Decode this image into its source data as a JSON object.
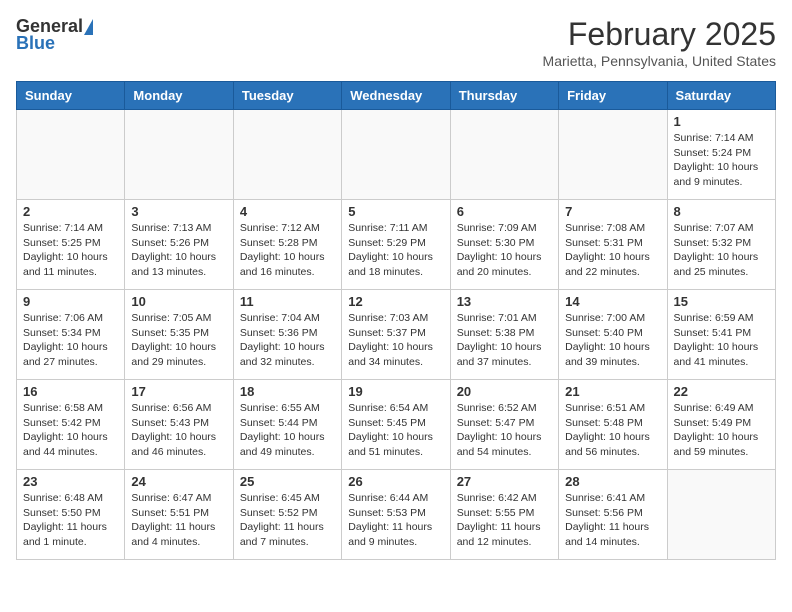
{
  "header": {
    "logo_general": "General",
    "logo_blue": "Blue",
    "month_title": "February 2025",
    "location": "Marietta, Pennsylvania, United States"
  },
  "days_of_week": [
    "Sunday",
    "Monday",
    "Tuesday",
    "Wednesday",
    "Thursday",
    "Friday",
    "Saturday"
  ],
  "weeks": [
    [
      {
        "num": "",
        "info": ""
      },
      {
        "num": "",
        "info": ""
      },
      {
        "num": "",
        "info": ""
      },
      {
        "num": "",
        "info": ""
      },
      {
        "num": "",
        "info": ""
      },
      {
        "num": "",
        "info": ""
      },
      {
        "num": "1",
        "info": "Sunrise: 7:14 AM\nSunset: 5:24 PM\nDaylight: 10 hours\nand 9 minutes."
      }
    ],
    [
      {
        "num": "2",
        "info": "Sunrise: 7:14 AM\nSunset: 5:25 PM\nDaylight: 10 hours\nand 11 minutes."
      },
      {
        "num": "3",
        "info": "Sunrise: 7:13 AM\nSunset: 5:26 PM\nDaylight: 10 hours\nand 13 minutes."
      },
      {
        "num": "4",
        "info": "Sunrise: 7:12 AM\nSunset: 5:28 PM\nDaylight: 10 hours\nand 16 minutes."
      },
      {
        "num": "5",
        "info": "Sunrise: 7:11 AM\nSunset: 5:29 PM\nDaylight: 10 hours\nand 18 minutes."
      },
      {
        "num": "6",
        "info": "Sunrise: 7:09 AM\nSunset: 5:30 PM\nDaylight: 10 hours\nand 20 minutes."
      },
      {
        "num": "7",
        "info": "Sunrise: 7:08 AM\nSunset: 5:31 PM\nDaylight: 10 hours\nand 22 minutes."
      },
      {
        "num": "8",
        "info": "Sunrise: 7:07 AM\nSunset: 5:32 PM\nDaylight: 10 hours\nand 25 minutes."
      }
    ],
    [
      {
        "num": "9",
        "info": "Sunrise: 7:06 AM\nSunset: 5:34 PM\nDaylight: 10 hours\nand 27 minutes."
      },
      {
        "num": "10",
        "info": "Sunrise: 7:05 AM\nSunset: 5:35 PM\nDaylight: 10 hours\nand 29 minutes."
      },
      {
        "num": "11",
        "info": "Sunrise: 7:04 AM\nSunset: 5:36 PM\nDaylight: 10 hours\nand 32 minutes."
      },
      {
        "num": "12",
        "info": "Sunrise: 7:03 AM\nSunset: 5:37 PM\nDaylight: 10 hours\nand 34 minutes."
      },
      {
        "num": "13",
        "info": "Sunrise: 7:01 AM\nSunset: 5:38 PM\nDaylight: 10 hours\nand 37 minutes."
      },
      {
        "num": "14",
        "info": "Sunrise: 7:00 AM\nSunset: 5:40 PM\nDaylight: 10 hours\nand 39 minutes."
      },
      {
        "num": "15",
        "info": "Sunrise: 6:59 AM\nSunset: 5:41 PM\nDaylight: 10 hours\nand 41 minutes."
      }
    ],
    [
      {
        "num": "16",
        "info": "Sunrise: 6:58 AM\nSunset: 5:42 PM\nDaylight: 10 hours\nand 44 minutes."
      },
      {
        "num": "17",
        "info": "Sunrise: 6:56 AM\nSunset: 5:43 PM\nDaylight: 10 hours\nand 46 minutes."
      },
      {
        "num": "18",
        "info": "Sunrise: 6:55 AM\nSunset: 5:44 PM\nDaylight: 10 hours\nand 49 minutes."
      },
      {
        "num": "19",
        "info": "Sunrise: 6:54 AM\nSunset: 5:45 PM\nDaylight: 10 hours\nand 51 minutes."
      },
      {
        "num": "20",
        "info": "Sunrise: 6:52 AM\nSunset: 5:47 PM\nDaylight: 10 hours\nand 54 minutes."
      },
      {
        "num": "21",
        "info": "Sunrise: 6:51 AM\nSunset: 5:48 PM\nDaylight: 10 hours\nand 56 minutes."
      },
      {
        "num": "22",
        "info": "Sunrise: 6:49 AM\nSunset: 5:49 PM\nDaylight: 10 hours\nand 59 minutes."
      }
    ],
    [
      {
        "num": "23",
        "info": "Sunrise: 6:48 AM\nSunset: 5:50 PM\nDaylight: 11 hours\nand 1 minute."
      },
      {
        "num": "24",
        "info": "Sunrise: 6:47 AM\nSunset: 5:51 PM\nDaylight: 11 hours\nand 4 minutes."
      },
      {
        "num": "25",
        "info": "Sunrise: 6:45 AM\nSunset: 5:52 PM\nDaylight: 11 hours\nand 7 minutes."
      },
      {
        "num": "26",
        "info": "Sunrise: 6:44 AM\nSunset: 5:53 PM\nDaylight: 11 hours\nand 9 minutes."
      },
      {
        "num": "27",
        "info": "Sunrise: 6:42 AM\nSunset: 5:55 PM\nDaylight: 11 hours\nand 12 minutes."
      },
      {
        "num": "28",
        "info": "Sunrise: 6:41 AM\nSunset: 5:56 PM\nDaylight: 11 hours\nand 14 minutes."
      },
      {
        "num": "",
        "info": ""
      }
    ]
  ]
}
